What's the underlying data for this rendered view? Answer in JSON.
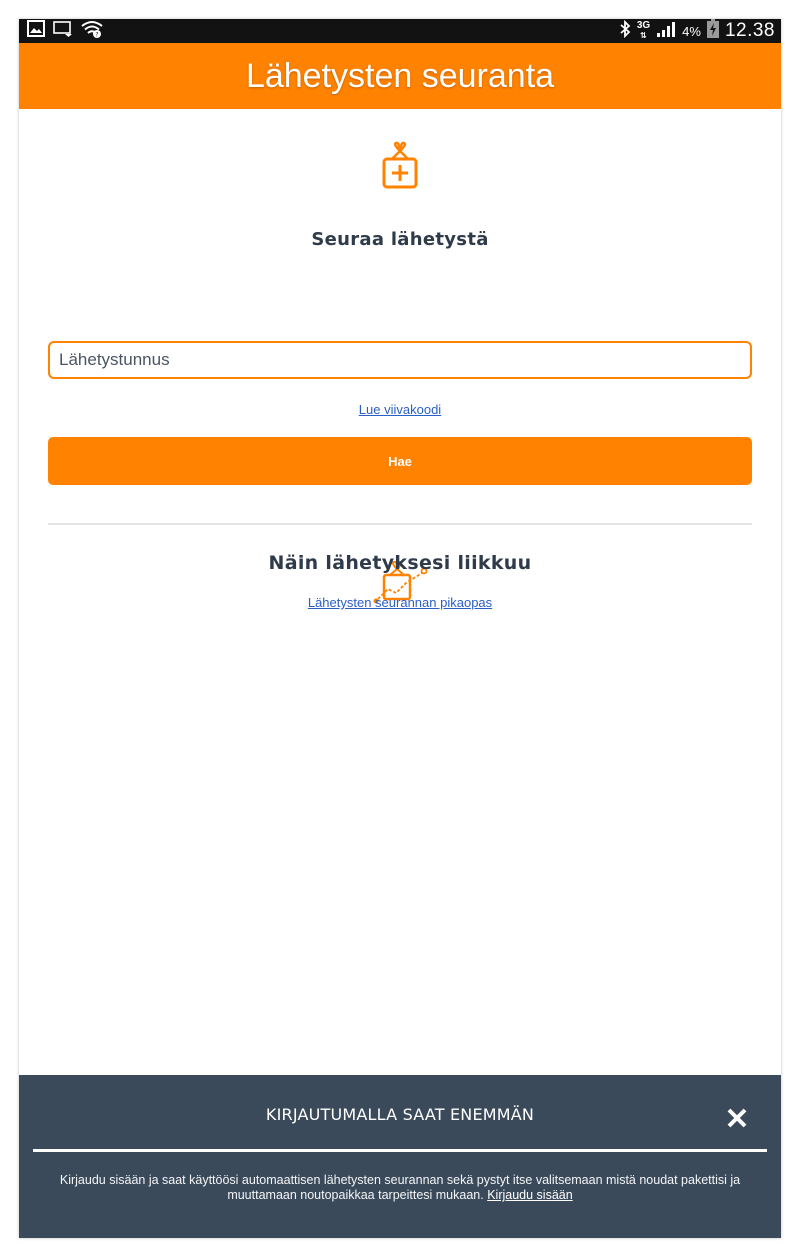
{
  "status_bar": {
    "time": "12.38",
    "battery_percent": "4%",
    "network": "3G",
    "icons": [
      "gallery-icon",
      "cast-icon",
      "wifi-icon",
      "bluetooth-icon",
      "signal-icon",
      "battery-charging-icon"
    ]
  },
  "header": {
    "title": "Lähetysten seuranta"
  },
  "track": {
    "icon": "package-add-icon",
    "title": "Seuraa lähetystä",
    "input_placeholder": "Lähetystunnus",
    "scan_link": "Lue viivakoodi",
    "search_button": "Hae"
  },
  "guide": {
    "icon": "package-route-icon",
    "title": "Näin lähetyksesi liikkuu",
    "link": "Lähetysten seurannan pikaopas"
  },
  "login_banner": {
    "title": "KIRJAUTUMALLA SAAT ENEMMÄN",
    "text": "Kirjaudu sisään ja saat käyttöösi automaattisen lähetysten seurannan sekä pystyt itse valitsemaan mistä noudat pakettisi ja muuttamaan noutopaikkaa tarpeittesi mukaan.",
    "login_link": "Kirjaudu sisään"
  },
  "colors": {
    "brand_orange": "#ff8200",
    "banner_bg": "#3b4a5a",
    "link_blue": "#2a5fc4",
    "title_text": "#2f3b4a"
  }
}
